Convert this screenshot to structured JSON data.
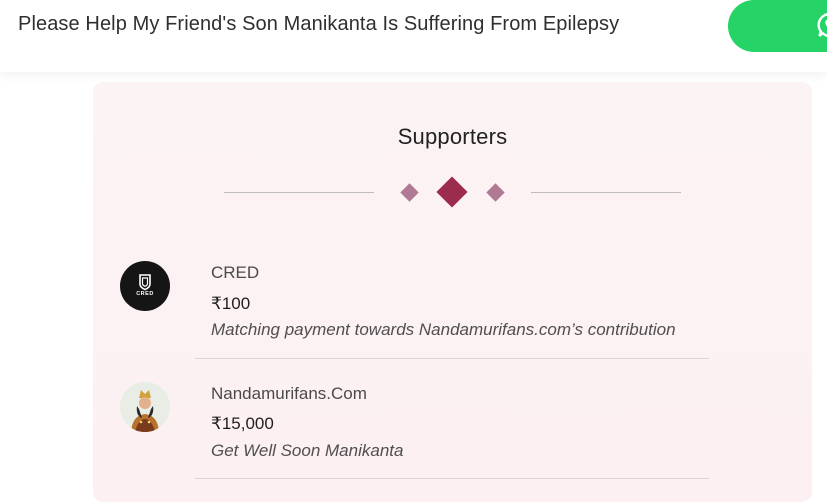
{
  "header": {
    "title": "Please Help My Friend's Son Manikanta Is Suffering From Epilepsy",
    "share_icon": "whatsapp-icon",
    "share_color": "#25d366"
  },
  "supporters": {
    "title": "Supporters",
    "accent_color": "#9b2c4e",
    "items": [
      {
        "name": "CRED",
        "avatar_text": "CRED",
        "amount": "₹100",
        "message": "Matching payment towards Nandamurifans.com’s contribution"
      },
      {
        "name": "Nandamurifans.Com",
        "amount": "₹15,000",
        "message": "Get Well Soon Manikanta"
      }
    ]
  }
}
